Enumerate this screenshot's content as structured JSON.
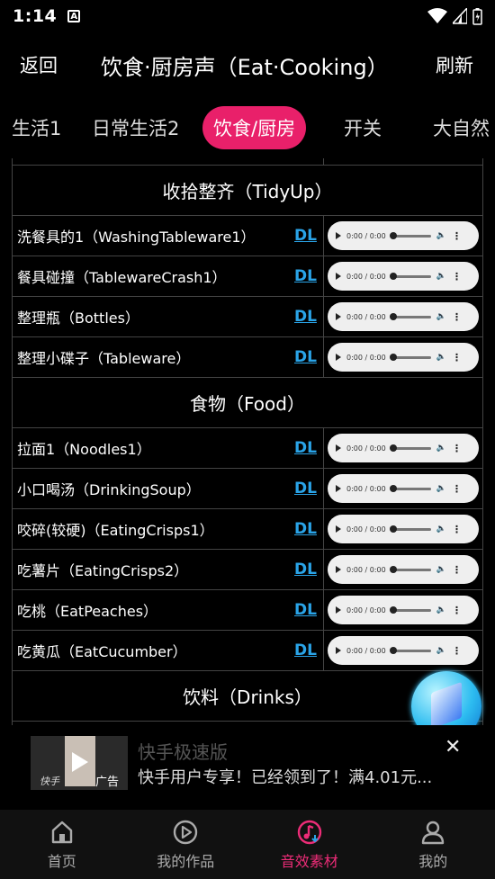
{
  "status": {
    "time": "1:14",
    "a_badge": "A"
  },
  "header": {
    "back": "返回",
    "title": "饮食·厨房声（Eat·Cooking）",
    "refresh": "刷新"
  },
  "tabs": [
    {
      "label": "生活1"
    },
    {
      "label": "日常生活2"
    },
    {
      "label": "饮食/厨房"
    },
    {
      "label": "开关"
    },
    {
      "label": "大自然"
    }
  ],
  "dl_label": "DL",
  "player_time": "0:00 / 0:00",
  "sections": [
    {
      "title": "收拾整齐（TidyUp）",
      "items": [
        "洗餐具的1（WashingTableware1）",
        "餐具碰撞（TablewareCrash1）",
        "整理瓶（Bottles）",
        "整理小碟子（Tableware）"
      ]
    },
    {
      "title": "食物（Food）",
      "items": [
        "拉面1（Noodles1）",
        "小口喝汤（DrinkingSoup）",
        "咬碎(较硬)（EatingCrisps1）",
        "吃薯片（EatingCrisps2）",
        "吃桃（EatPeaches）",
        "吃黄瓜（EatCucumber）"
      ]
    },
    {
      "title": "饮料（Drinks）",
      "items": []
    }
  ],
  "ad": {
    "title": "快手极速版",
    "desc": "快手用户专享！已经领到了！满4.01元...",
    "tag": "广告",
    "logo": "快手",
    "close": "✕"
  },
  "bottom_nav": [
    {
      "label": "首页",
      "icon": "home-icon"
    },
    {
      "label": "我的作品",
      "icon": "play-circle-icon"
    },
    {
      "label": "音效素材",
      "icon": "music-download-icon"
    },
    {
      "label": "我的",
      "icon": "user-icon"
    }
  ],
  "colors": {
    "accent": "#e9206a",
    "link": "#2aa4e8",
    "background": "#000000"
  }
}
